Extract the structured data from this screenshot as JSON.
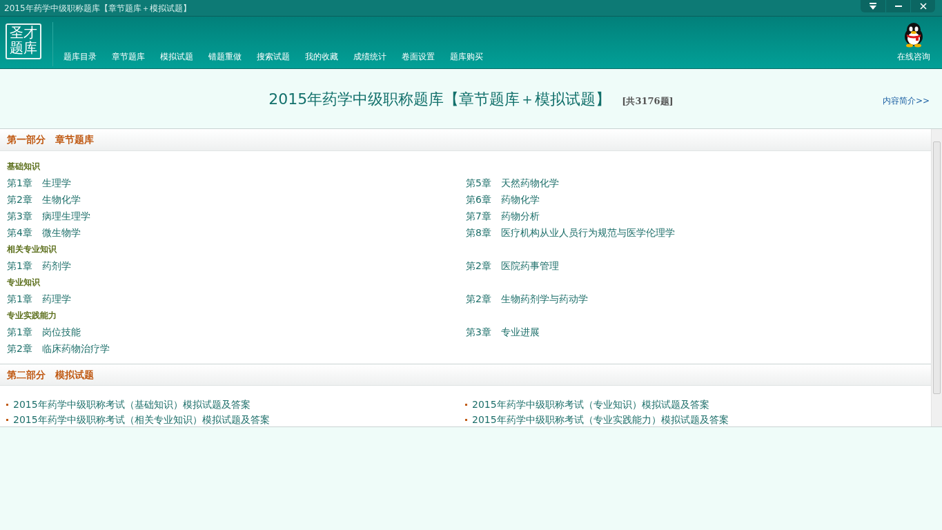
{
  "window": {
    "title": "2015年药学中级职称题库【章节题库＋模拟试题】",
    "controls": [
      {
        "kind": "menu"
      },
      {
        "kind": "minimize"
      },
      {
        "kind": "close"
      }
    ]
  },
  "logo": {
    "lines": [
      "圣才",
      "题库"
    ]
  },
  "nav": [
    "题库目录",
    "章节题库",
    "模拟试题",
    "错题重做",
    "搜索试题",
    "我的收藏",
    "成绩统计",
    "卷面设置",
    "题库购买"
  ],
  "consult": {
    "label": "在线咨询"
  },
  "heading": {
    "title": "2015年药学中级职称题库【章节题库＋模拟试题】",
    "count": "[共3176题]",
    "intro_link": "内容简介>>"
  },
  "sections": [
    {
      "title": "第一部分　章节题库",
      "kind": "chapters",
      "groups": [
        {
          "title": "基础知识",
          "chapters": [
            {
              "number": "第1章",
              "name": "生理学"
            },
            {
              "number": "第5章",
              "name": "天然药物化学"
            },
            {
              "number": "第2章",
              "name": "生物化学"
            },
            {
              "number": "第6章",
              "name": "药物化学"
            },
            {
              "number": "第3章",
              "name": "病理生理学"
            },
            {
              "number": "第7章",
              "name": "药物分析"
            },
            {
              "number": "第4章",
              "name": "微生物学"
            },
            {
              "number": "第8章",
              "name": "医疗机构从业人员行为规范与医学伦理学"
            }
          ]
        },
        {
          "title": "相关专业知识",
          "chapters": [
            {
              "number": "第1章",
              "name": "药剂学"
            },
            {
              "number": "第2章",
              "name": "医院药事管理"
            }
          ]
        },
        {
          "title": "专业知识",
          "chapters": [
            {
              "number": "第1章",
              "name": "药理学"
            },
            {
              "number": "第2章",
              "name": "生物药剂学与药动学"
            }
          ]
        },
        {
          "title": "专业实践能力",
          "chapters": [
            {
              "number": "第1章",
              "name": "岗位技能"
            },
            {
              "number": "第3章",
              "name": "专业进展"
            },
            {
              "number": "第2章",
              "name": "临床药物治疗学"
            }
          ]
        }
      ]
    },
    {
      "title": "第二部分　模拟试题",
      "kind": "tests",
      "items": [
        "2015年药学中级职称考试（基础知识）模拟试题及答案",
        "2015年药学中级职称考试（专业知识）模拟试题及答案",
        "2015年药学中级职称考试（相关专业知识）模拟试题及答案",
        "2015年药学中级职称考试（专业实践能力）模拟试题及答案"
      ]
    }
  ]
}
